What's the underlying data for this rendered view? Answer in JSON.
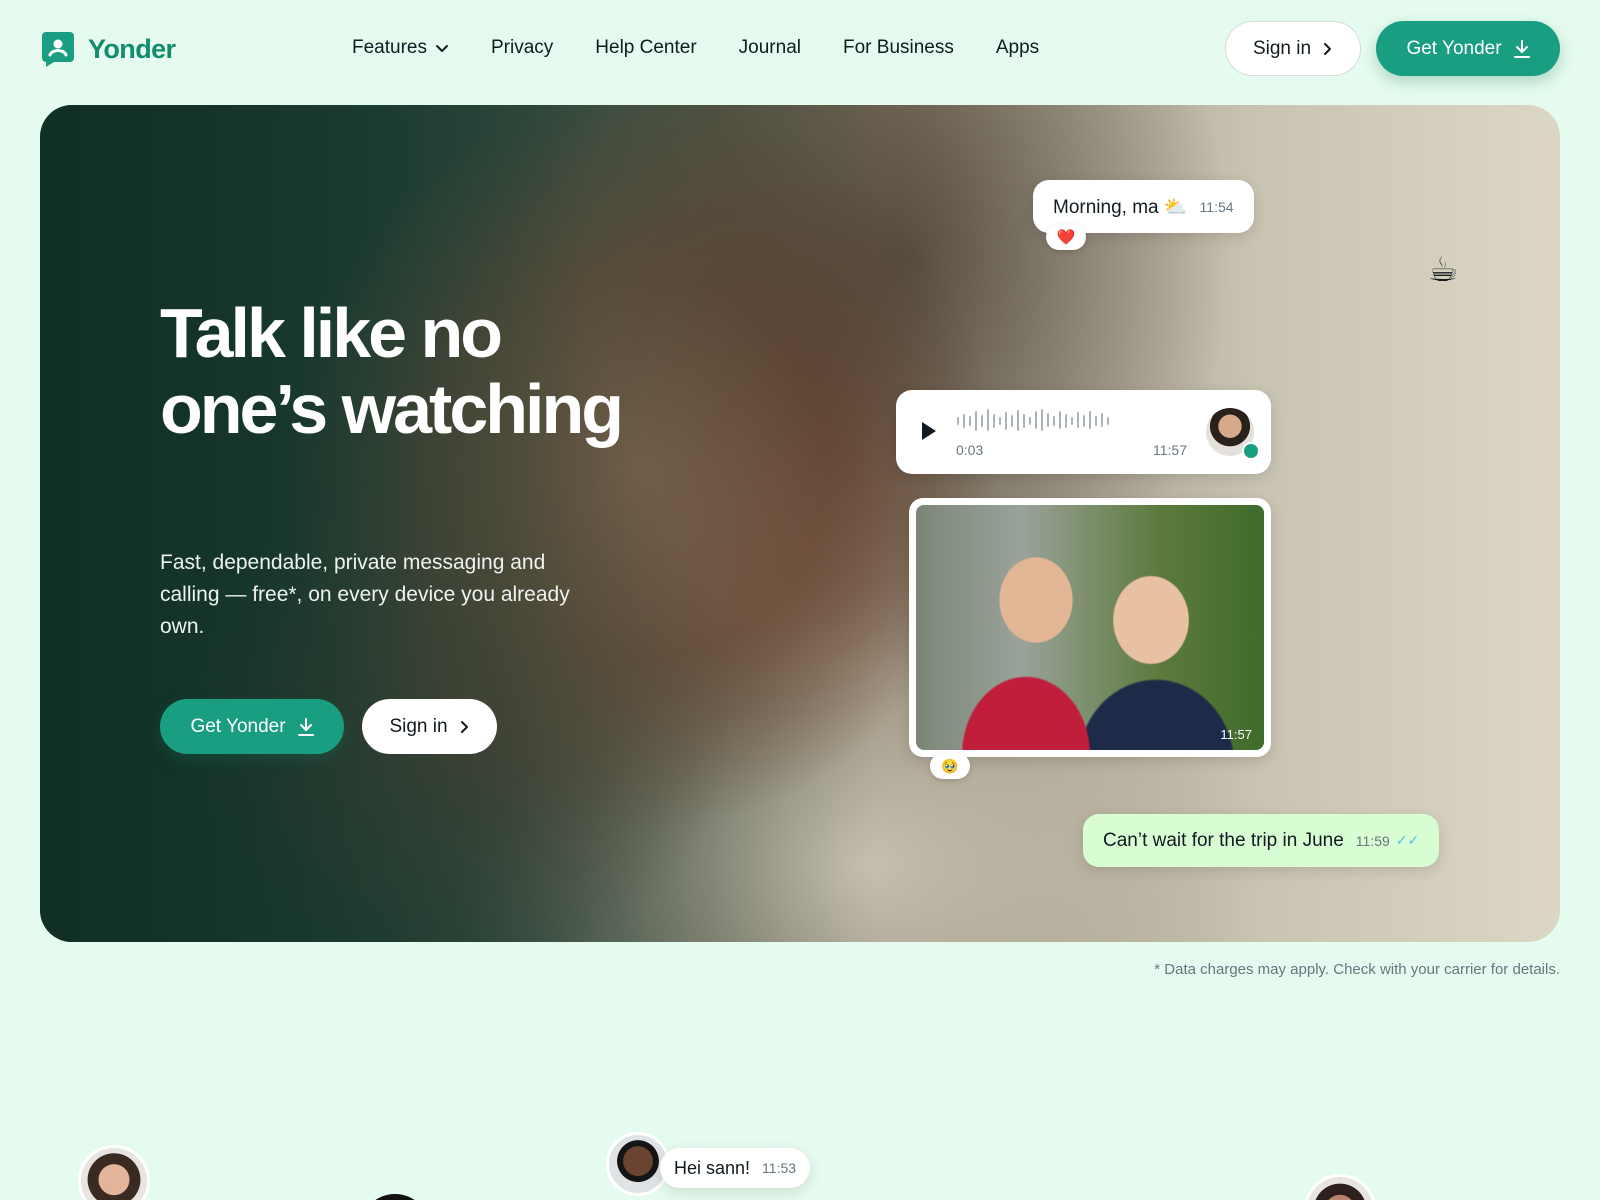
{
  "brand": {
    "name": "Yonder",
    "accent": "#1a9e82",
    "logo_color": "#128c6e",
    "background": "#e6fbef"
  },
  "nav": {
    "items": [
      {
        "label": "Features",
        "icon": "chevron-down-icon"
      },
      {
        "label": "Privacy"
      },
      {
        "label": "Help Center"
      },
      {
        "label": "Journal"
      },
      {
        "label": "For Business"
      },
      {
        "label": "Apps"
      }
    ]
  },
  "header": {
    "signin_label": "Sign in",
    "get_label": "Get Yonder"
  },
  "hero": {
    "title": "Talk like no one’s watching",
    "subtitle": "Fast, dependable, private messaging and calling — free*, on every device you already own.",
    "get_label": "Get Yonder",
    "signin_label": "Sign in",
    "messages": {
      "morning": {
        "text": "Morning, ma ⛅",
        "time": "11:54",
        "reaction": "❤️"
      },
      "voice": {
        "duration": "0:03",
        "time": "11:57"
      },
      "photo": {
        "time": "11:57",
        "reaction": "🥹"
      },
      "trip": {
        "text": "Can’t wait for the trip in June",
        "time": "11:59",
        "ticks": "✓✓"
      }
    },
    "decor": {
      "cup": "☕"
    }
  },
  "footnote": "* Data charges may apply. Check with your carrier for details.",
  "bottom": {
    "chat": {
      "text": "Hei sann!",
      "time": "11:53"
    }
  }
}
